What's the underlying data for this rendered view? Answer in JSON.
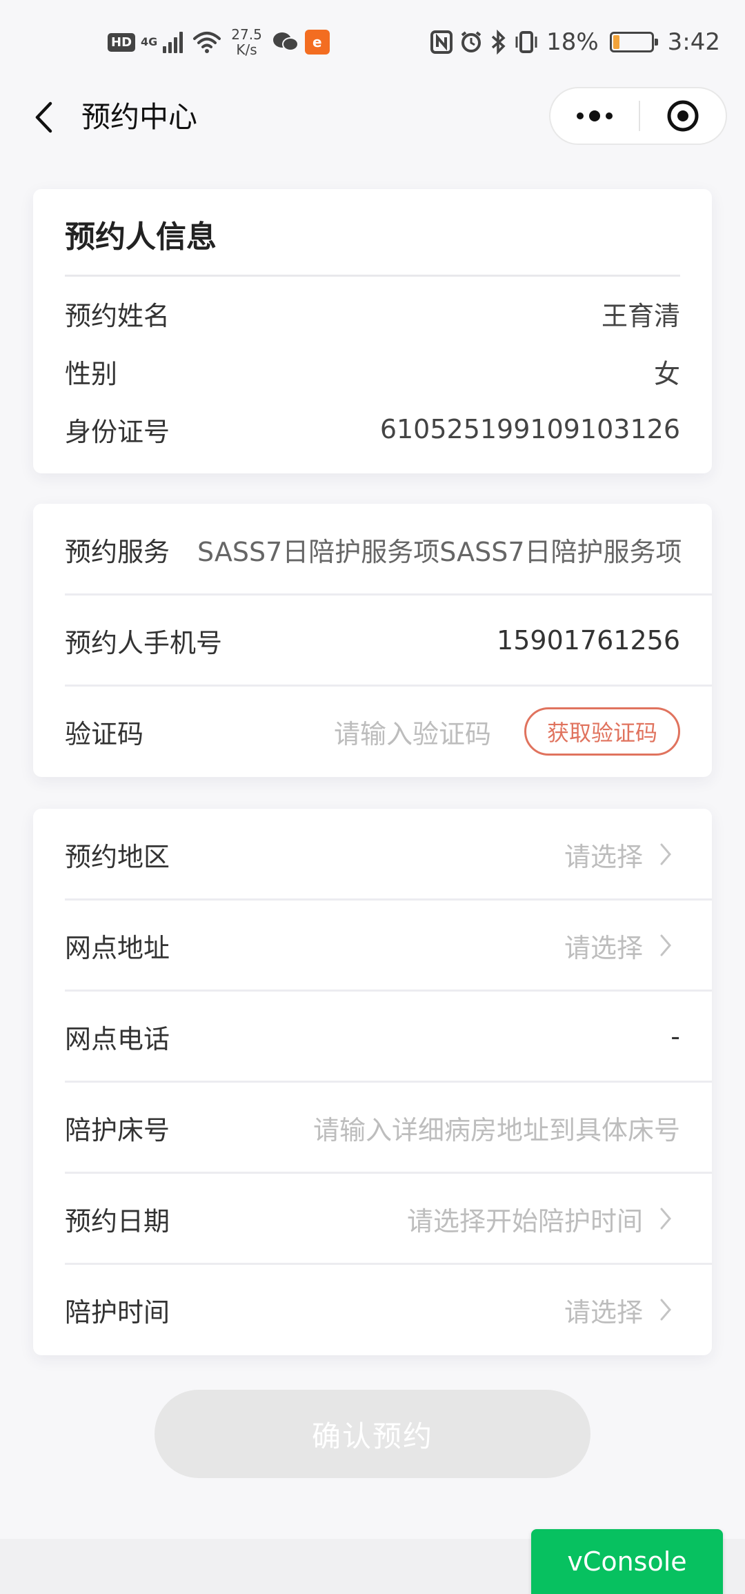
{
  "status_bar": {
    "hd": "HD",
    "network_gen": "4G",
    "net_speed_value": "27.5",
    "net_speed_unit": "K/s",
    "app_badge_text": "e",
    "battery_percent": "18%",
    "battery_level": 0.18,
    "time": "3:42",
    "colors": {
      "battery_fill": "#f2a33a",
      "app_badge": "#f36d21"
    }
  },
  "nav": {
    "title": "预约中心"
  },
  "booker_info": {
    "title": "预约人信息",
    "rows": [
      {
        "label": "预约姓名",
        "value": "王育清"
      },
      {
        "label": "性别",
        "value": "女"
      },
      {
        "label": "身份证号",
        "value": "610525199109103126"
      }
    ]
  },
  "service": {
    "service_label": "预约服务",
    "service_value": "SASS7日陪护服务项SASS7日陪护服务项",
    "phone_label": "预约人手机号",
    "phone_value": "15901761256",
    "code_label": "验证码",
    "code_placeholder": "请输入验证码",
    "code_button": "获取验证码"
  },
  "details": {
    "rows": [
      {
        "label": "预约地区",
        "placeholder": "请选择",
        "type": "select"
      },
      {
        "label": "网点地址",
        "placeholder": "请选择",
        "type": "select"
      },
      {
        "label": "网点电话",
        "value": "-",
        "type": "text"
      },
      {
        "label": "陪护床号",
        "placeholder": "请输入详细病房地址到具体床号",
        "type": "input"
      },
      {
        "label": "预约日期",
        "placeholder": "请选择开始陪护时间",
        "type": "select"
      },
      {
        "label": "陪护时间",
        "placeholder": "请选择",
        "type": "select"
      }
    ]
  },
  "actions": {
    "confirm": "确认预约",
    "vconsole": "vConsole"
  },
  "colors": {
    "accent": "#e0735e",
    "vconsole_green": "#07c160",
    "placeholder": "#bdbdbd",
    "disabled_button": "#e6e6e6"
  }
}
